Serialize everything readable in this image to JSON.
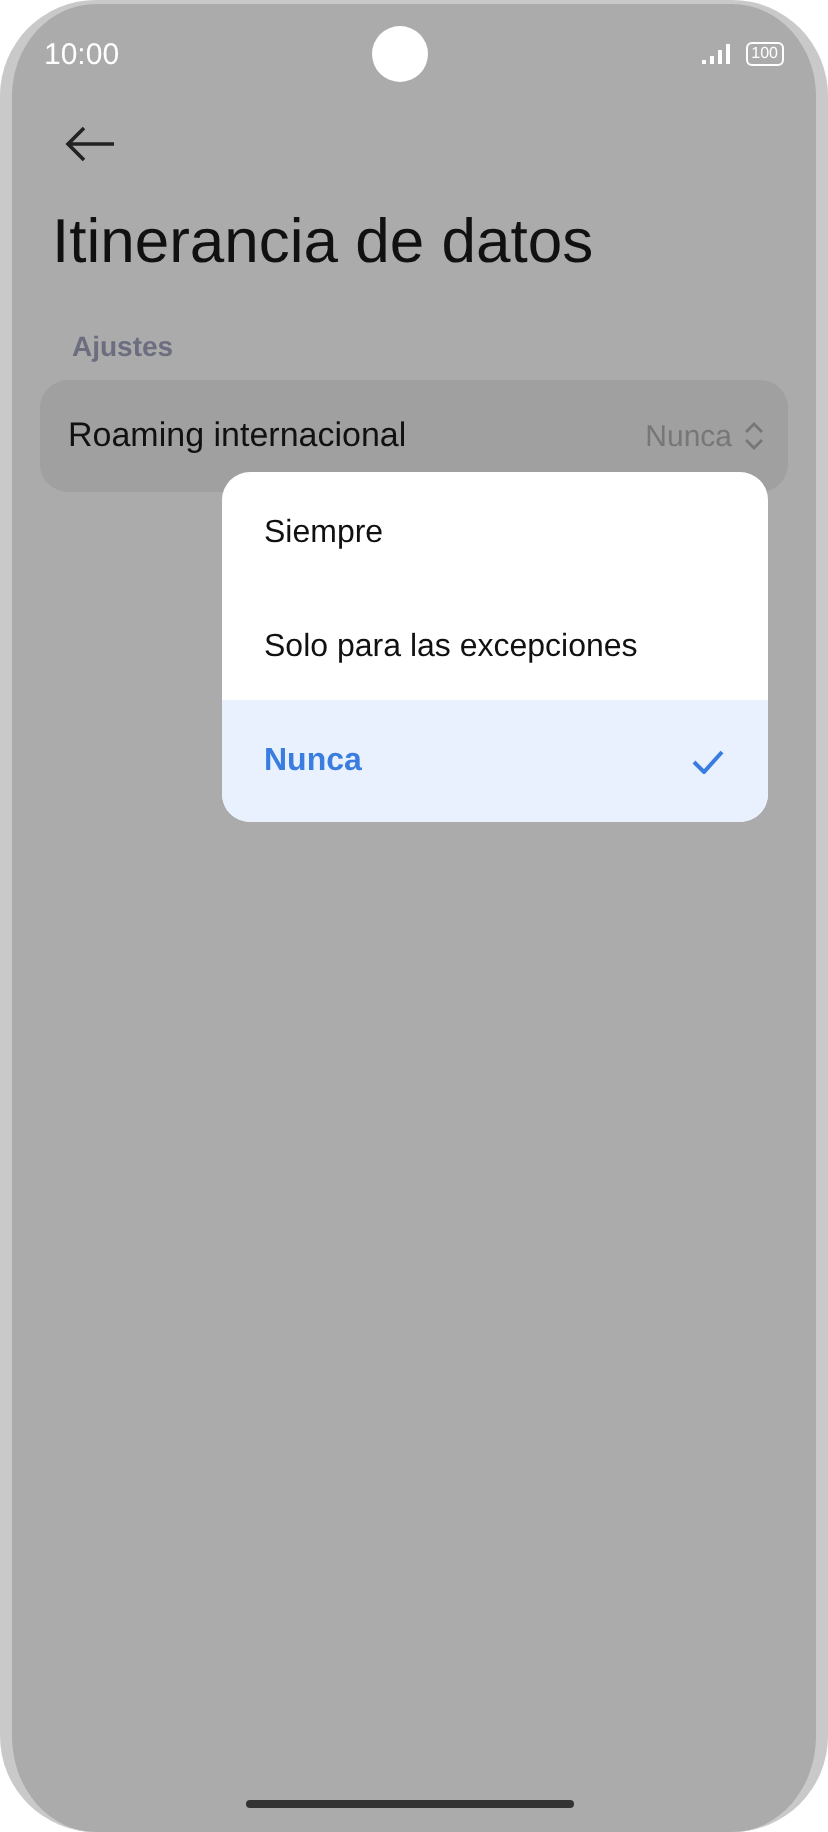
{
  "status_bar": {
    "time": "10:00",
    "battery": "100"
  },
  "title": "Itinerancia de datos",
  "section": "Ajustes",
  "setting": {
    "label": "Roaming internacional",
    "value": "Nunca"
  },
  "menu": {
    "options": [
      {
        "label": "Siempre",
        "selected": false
      },
      {
        "label": "Solo para las excepciones",
        "selected": false
      },
      {
        "label": "Nunca",
        "selected": true
      }
    ]
  }
}
